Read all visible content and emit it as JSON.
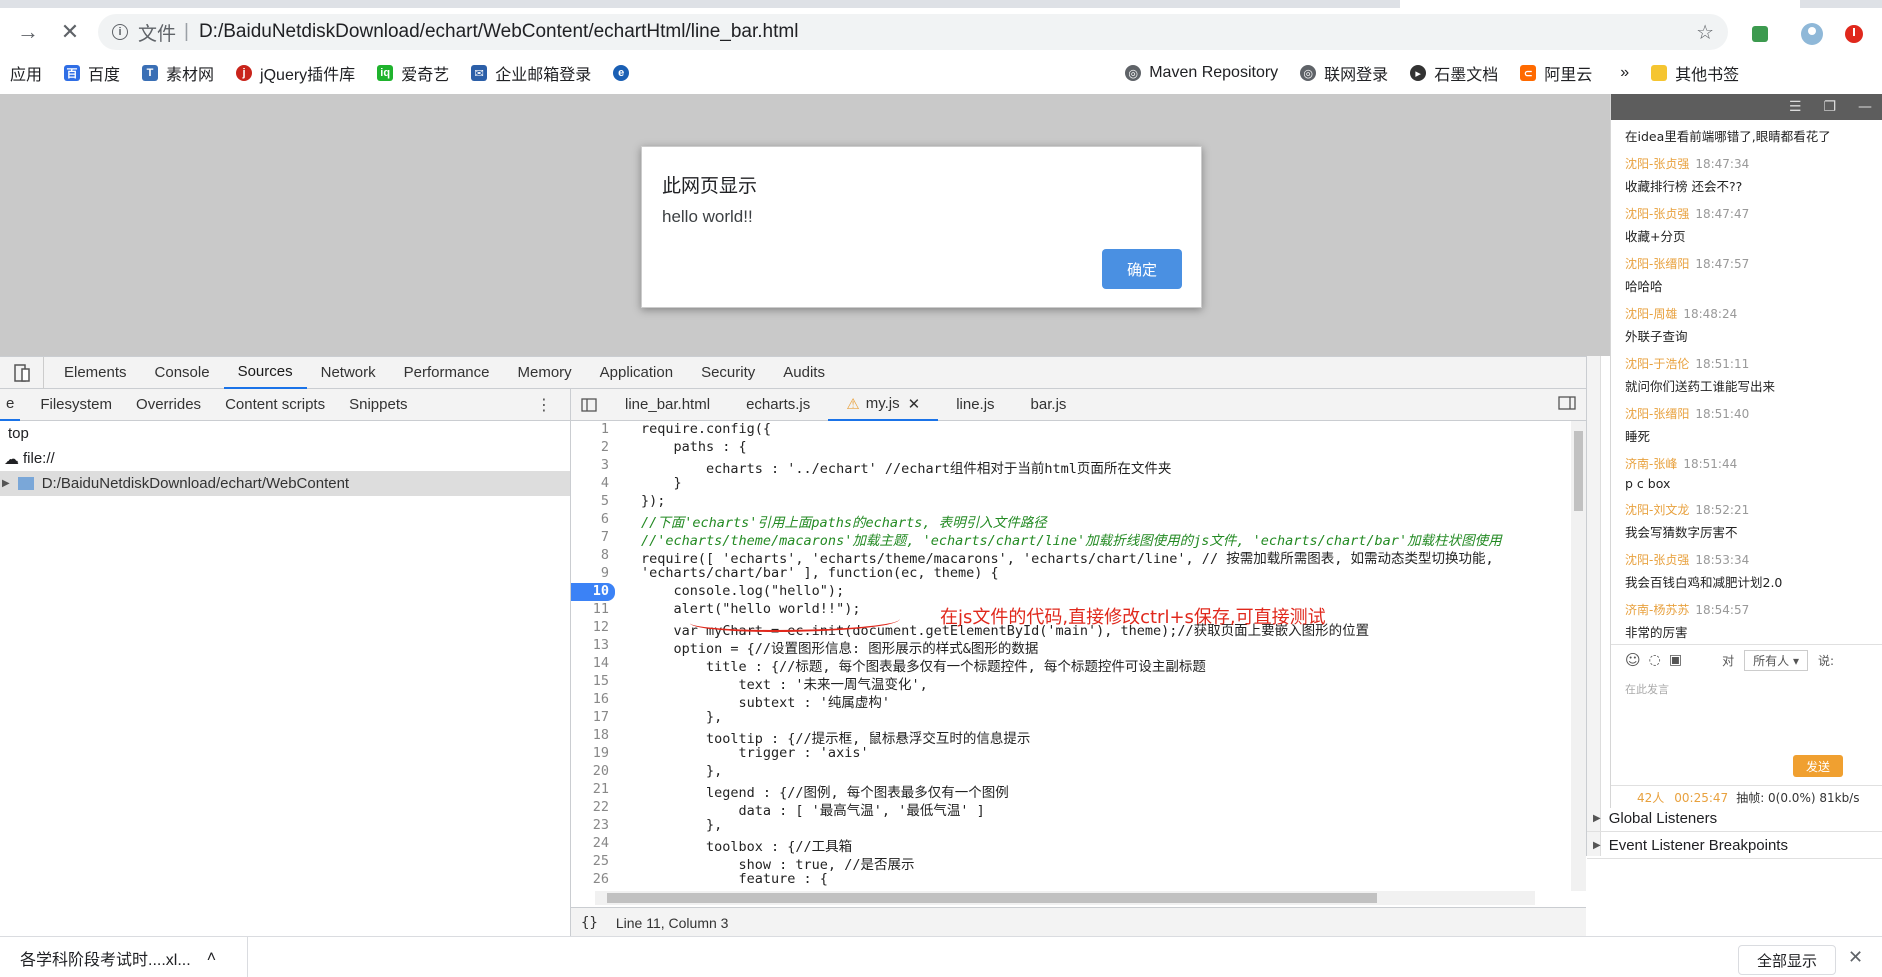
{
  "browser": {
    "scheme_label": "文件",
    "separator": "|",
    "url": "D:/BaiduNetdiskDownload/echart/WebContent/echartHtml/line_bar.html"
  },
  "bookmarks": [
    {
      "label": "应用",
      "icon": "apps-icon"
    },
    {
      "label": "百度",
      "icon": "baidu-icon"
    },
    {
      "label": "素材网",
      "icon": "sucai-icon"
    },
    {
      "label": "jQuery插件库",
      "icon": "jquery-icon"
    },
    {
      "label": "爱奇艺",
      "icon": "iqiyi-icon"
    },
    {
      "label": "企业邮箱登录",
      "icon": "mail-icon"
    },
    {
      "label": "",
      "icon": "link-icon"
    },
    {
      "label": "Maven Repository",
      "icon": "globe-icon"
    },
    {
      "label": "联网登录",
      "icon": "globe-icon"
    },
    {
      "label": "石墨文档",
      "icon": "shimo-icon"
    },
    {
      "label": "阿里云",
      "icon": "aliyun-icon"
    },
    {
      "label": "»",
      "icon": ""
    },
    {
      "label": "其他书签",
      "icon": "folder-icon"
    }
  ],
  "alert": {
    "title": "此网页显示",
    "message": "hello world!!",
    "ok_label": "确定"
  },
  "devtools": {
    "tabs": [
      "Elements",
      "Console",
      "Sources",
      "Network",
      "Performance",
      "Memory",
      "Application",
      "Security",
      "Audits"
    ],
    "active_tab": "Sources",
    "nav_subtabs": [
      "Filesystem",
      "Overrides",
      "Content scripts",
      "Snippets"
    ],
    "tree": [
      "top",
      "file://",
      "D:/BaiduNetdiskDownload/echart/WebContent"
    ],
    "editor_tabs": [
      "line_bar.html",
      "echarts.js",
      "my.js",
      "line.js",
      "bar.js"
    ],
    "active_editor_tab": "my.js",
    "status": "Line 11, Column 3",
    "status_icon": "{}",
    "breakpoint_line": 10,
    "code_lines": [
      "require.config({",
      "    paths : {",
      "        echarts : '../echart' //echart组件相对于当前html页面所在文件夹",
      "    }",
      "});",
      "//下面'echarts'引用上面paths的echarts, 表明引入文件路径",
      "//'echarts/theme/macarons'加载主题, 'echarts/chart/line'加载折线图使用的js文件, 'echarts/chart/bar'加载柱状图使用",
      "require([ 'echarts', 'echarts/theme/macarons', 'echarts/chart/line', // 按需加载所需图表, 如需动态类型切换功能, ",
      "'echarts/chart/bar' ], function(ec, theme) {",
      "    console.log(\"hello\");",
      "    alert(\"hello world!!\");",
      "    var myChart = ec.init(document.getElementById('main'), theme);//获取页面上要嵌入图形的位置",
      "    option = {//设置图形信息: 图形展示的样式&图形的数据",
      "        title : {//标题, 每个图表最多仅有一个标题控件, 每个标题控件可设主副标题",
      "            text : '未来一周气温变化',",
      "            subtext : '纯属虚构'",
      "        },",
      "        tooltip : {//提示框, 鼠标悬浮交互时的信息提示",
      "            trigger : 'axis'",
      "        },",
      "        legend : {//图例, 每个图表最多仅有一个图例",
      "            data : [ '最高气温', '最低气温' ]",
      "        },",
      "        toolbox : {//工具箱",
      "            show : true, //是否展示",
      "            feature : {",
      ""
    ],
    "annotation": "在js文件的代码,直接修改ctrl+s保存,可直接测试",
    "sidebar_sections": [
      "Global Listeners",
      "Event Listener Breakpoints"
    ]
  },
  "chat": {
    "first_line": "在idea里看前端哪错了,眼睛都看花了",
    "messages": [
      {
        "who": "沈阳-张贞强",
        "time": "18:47:34",
        "text": "收藏排行榜     还会不??"
      },
      {
        "who": "沈阳-张贞强",
        "time": "18:47:47",
        "text": "收藏+分页"
      },
      {
        "who": "沈阳-张缙阳",
        "time": "18:47:57",
        "text": "哈哈哈"
      },
      {
        "who": "沈阳-周雄",
        "time": "18:48:24",
        "text": "外联子查询"
      },
      {
        "who": "沈阳-于浩伦",
        "time": "18:51:11",
        "text": "就问你们送药工谁能写出来"
      },
      {
        "who": "沈阳-张缙阳",
        "time": "18:51:40",
        "text": "睡死"
      },
      {
        "who": "济南-张峰",
        "time": "18:51:44",
        "text": "p  c  box"
      },
      {
        "who": "沈阳-刘文龙",
        "time": "18:52:21",
        "text": "我会写猜数字厉害不"
      },
      {
        "who": "沈阳-张贞强",
        "time": "18:53:34",
        "text": "我会百钱白鸡和减肥计划2.0"
      },
      {
        "who": "济南-杨苏苏",
        "time": "18:54:57",
        "text": "非常的厉害"
      }
    ],
    "to_label": "对",
    "to_value": "所有人",
    "say_label": "说:",
    "input_placeholder": "在此发言",
    "send_label": "发送",
    "footer_count": "42人",
    "footer_time": "00:25:47",
    "footer_stats": "抽帧: 0(0.0%) 81kb/s"
  },
  "downloads": {
    "item": "各学科阶段考试时....xl...",
    "show_all": "全部显示"
  },
  "colors": {
    "accent": "#1a73e8",
    "alert_ok": "#4a90e2",
    "annotation": "#e0281c",
    "chat_name": "#e8a13e"
  }
}
